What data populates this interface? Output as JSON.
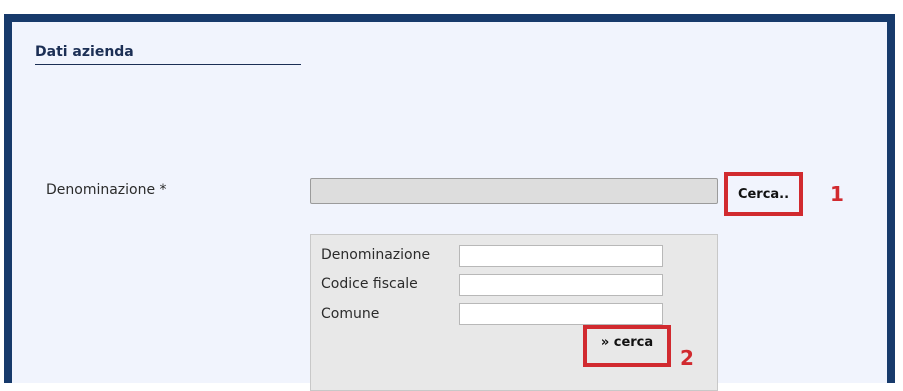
{
  "section": {
    "title": "Dati azienda"
  },
  "form": {
    "denominazione_label": "Denominazione *",
    "denominazione_value": "",
    "cerca_button": "Cerca..",
    "callout_1": "1"
  },
  "search_panel": {
    "fields": [
      {
        "label": "Denominazione",
        "value": ""
      },
      {
        "label": "Codice fiscale",
        "value": ""
      },
      {
        "label": "Comune",
        "value": ""
      }
    ],
    "search_button": "» cerca",
    "callout_2": "2"
  },
  "colors": {
    "frame": "#173a6b",
    "background": "#f1f4fd",
    "highlight": "#d12a2f"
  }
}
